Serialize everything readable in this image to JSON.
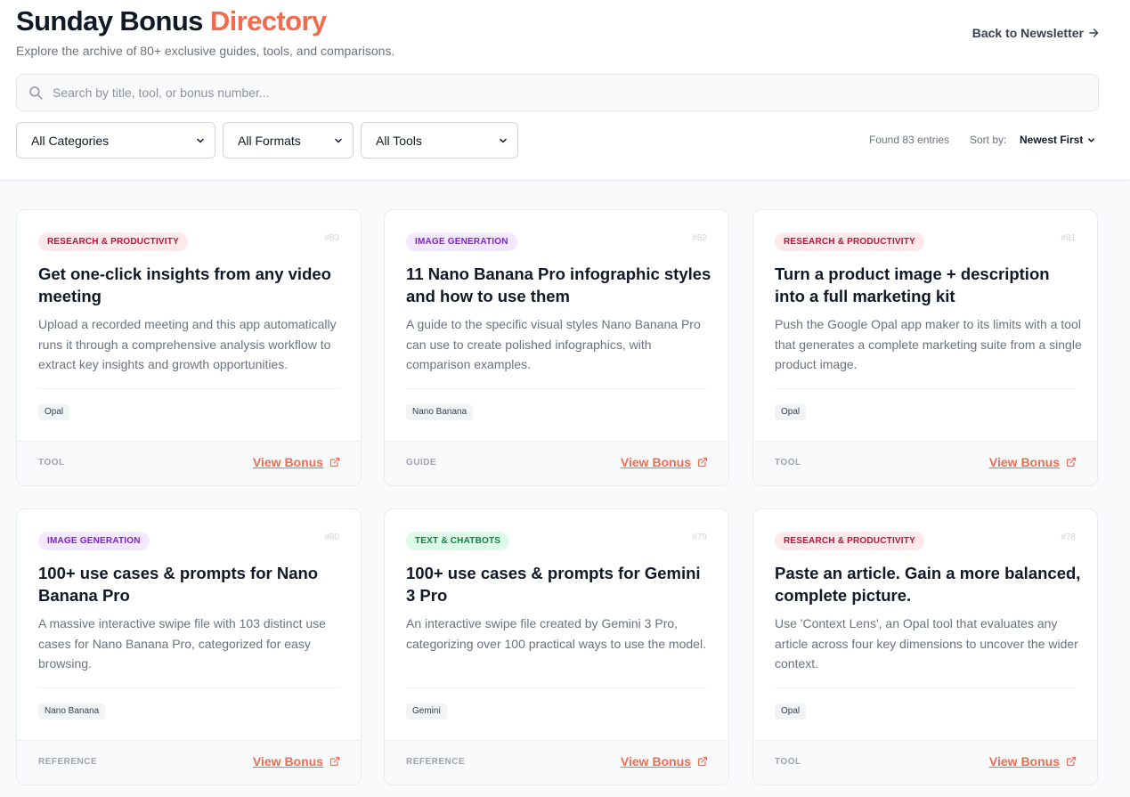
{
  "header": {
    "title_main": "Sunday Bonus",
    "title_accent": "Directory",
    "subtitle": "Explore the archive of 80+ exclusive guides, tools, and comparisons.",
    "back_link": "Back to Newsletter"
  },
  "search": {
    "placeholder": "Search by title, tool, or bonus number...",
    "value": ""
  },
  "filters": {
    "category": "All Categories",
    "format": "All Formats",
    "tool": "All Tools"
  },
  "results": {
    "found": "Found 83 entries",
    "sort_label": "Sort by:",
    "sort_value": "Newest First"
  },
  "colors": {
    "accent": "#f26b4f",
    "research_badge_bg": "#fde8ec",
    "research_badge_text": "#be123c",
    "image_badge_bg": "#f3e8ff",
    "image_badge_text": "#7e22ce",
    "text_badge_bg": "#dcfce7",
    "text_badge_text": "#15803d"
  },
  "cards": [
    {
      "category": "RESEARCH & PRODUCTIVITY",
      "number": "#83",
      "title": "Get one-click insights from any video meeting",
      "description": "Upload a recorded meeting and this app automatically runs it through a comprehensive analysis workflow to extract key insights and growth opportunities.",
      "tag": "Opal",
      "type": "TOOL",
      "action": "View Bonus"
    },
    {
      "category": "IMAGE GENERATION",
      "number": "#82",
      "title": "11 Nano Banana Pro infographic styles and how to use them",
      "description": "A guide to the specific visual styles Nano Banana Pro can use to create polished infographics, with comparison examples.",
      "tag": "Nano Banana",
      "type": "GUIDE",
      "action": "View Bonus"
    },
    {
      "category": "RESEARCH & PRODUCTIVITY",
      "number": "#81",
      "title": "Turn a product image + description into a full marketing kit",
      "description": "Push the Google Opal app maker to its limits with a tool that generates a complete marketing suite from a single product image.",
      "tag": "Opal",
      "type": "TOOL",
      "action": "View Bonus"
    },
    {
      "category": "IMAGE GENERATION",
      "number": "#80",
      "title": "100+ use cases & prompts for Nano Banana Pro",
      "description": "A massive interactive swipe file with 103 distinct use cases for Nano Banana Pro, categorized for easy browsing.",
      "tag": "Nano Banana",
      "type": "REFERENCE",
      "action": "View Bonus"
    },
    {
      "category": "TEXT & CHATBOTS",
      "number": "#79",
      "title": "100+ use cases & prompts for Gemini 3 Pro",
      "description": "An interactive swipe file created by Gemini 3 Pro, categorizing over 100 practical ways to use the model.",
      "tag": "Gemini",
      "type": "REFERENCE",
      "action": "View Bonus"
    },
    {
      "category": "RESEARCH & PRODUCTIVITY",
      "number": "#78",
      "title": "Paste an article. Gain a more balanced, complete picture.",
      "description": "Use 'Context Lens', an Opal tool that evaluates any article across four key dimensions to uncover the wider context.",
      "tag": "Opal",
      "type": "TOOL",
      "action": "View Bonus"
    }
  ]
}
